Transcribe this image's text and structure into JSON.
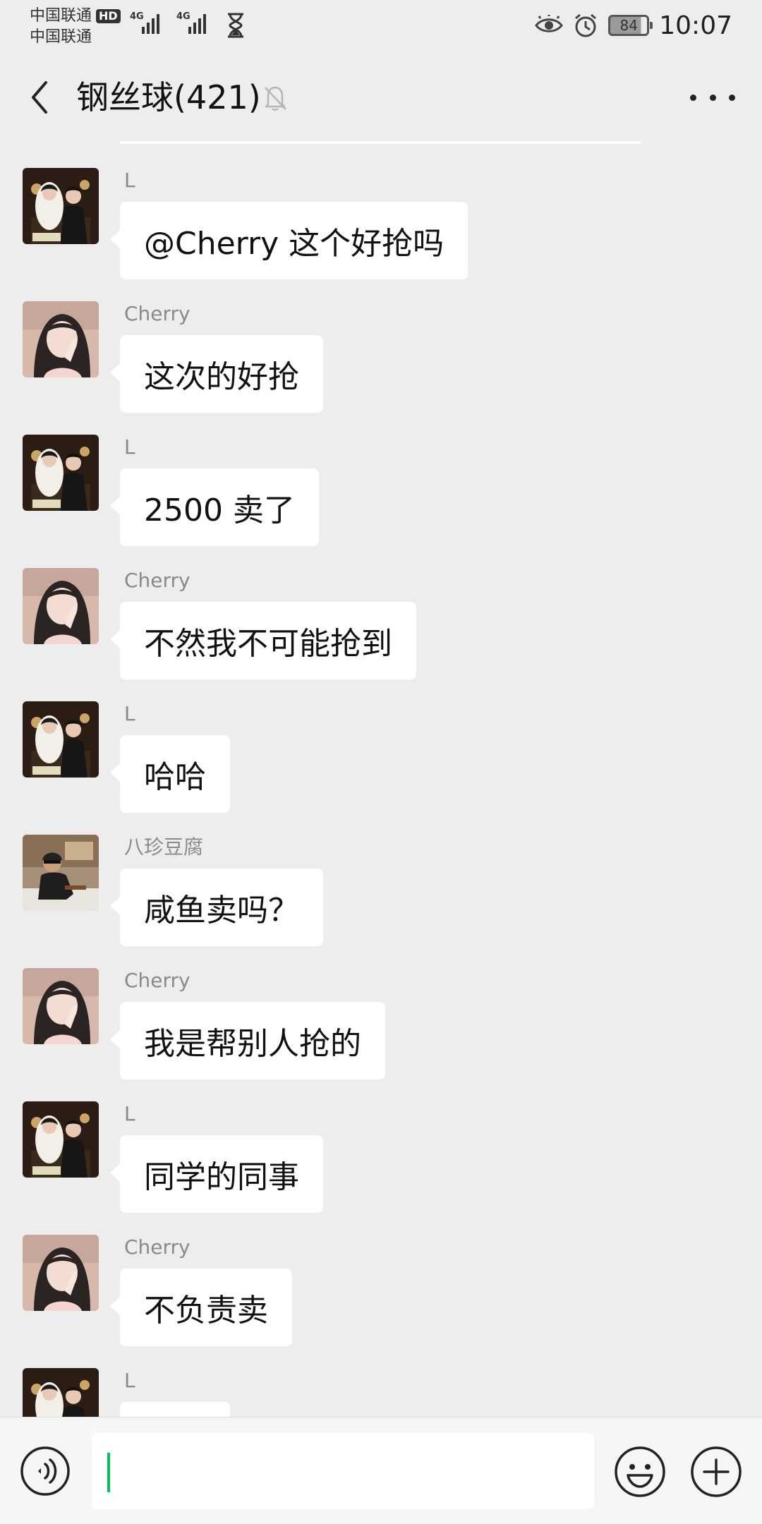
{
  "status_bar": {
    "carrier_1": "中国联通",
    "carrier_2": "中国联通",
    "hd_badge": "HD",
    "network_1": "4G",
    "network_2": "4G",
    "battery": "84",
    "battery_level": 0.84,
    "time": "10:07",
    "icons": [
      "eye-comfort-icon",
      "alarm-icon",
      "hourglass-icon"
    ]
  },
  "header": {
    "title": "钢丝球(421)",
    "back_icon": "chevron-left-icon",
    "mute_icon": "bell-off-icon",
    "more_icon": "more-icon"
  },
  "messages": [
    {
      "sender": "L",
      "text": "@Cherry  这个好抢吗",
      "avatar": "couple-photo"
    },
    {
      "sender": "Cherry",
      "text": "这次的好抢",
      "avatar": "girl-photo"
    },
    {
      "sender": "L",
      "text": "2500 卖了",
      "avatar": "couple-photo"
    },
    {
      "sender": "Cherry",
      "text": "不然我不可能抢到",
      "avatar": "girl-photo"
    },
    {
      "sender": "L",
      "text": "哈哈",
      "avatar": "couple-photo"
    },
    {
      "sender": "八珍豆腐",
      "text": "咸鱼卖吗？",
      "avatar": "person-photo"
    },
    {
      "sender": "Cherry",
      "text": "我是帮别人抢的",
      "avatar": "girl-photo"
    },
    {
      "sender": "L",
      "text": "同学的同事",
      "avatar": "couple-photo"
    },
    {
      "sender": "Cherry",
      "text": "不负责卖",
      "avatar": "girl-photo"
    },
    {
      "sender": "L",
      "text": "",
      "avatar": "couple-photo"
    }
  ],
  "input_bar": {
    "text_value": "",
    "voice_icon": "voice-icon",
    "emoji_icon": "emoji-icon",
    "plus_icon": "plus-icon"
  },
  "colors": {
    "background": "#ededed",
    "bubble": "#ffffff",
    "caret": "#07c160",
    "sender": "#8a8a8a"
  }
}
